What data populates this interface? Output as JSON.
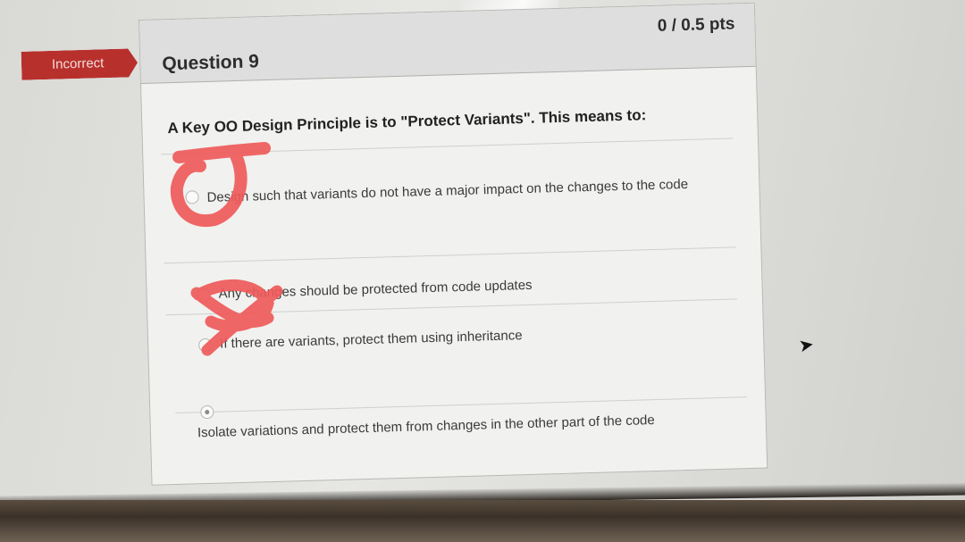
{
  "status_tag": "Incorrect",
  "question": {
    "title": "Question 9",
    "points": "0 / 0.5 pts",
    "prompt": "A Key OO Design Principle is to \"Protect Variants\". This means to:"
  },
  "answers": [
    {
      "text": "Design such that variants do not have a major impact on the changes to the code",
      "selected": false
    },
    {
      "text": "Any changes should be protected from code updates",
      "selected": false
    },
    {
      "text": "If there are variants, protect them using inheritance",
      "selected": false
    },
    {
      "text": "Isolate variations and protect them from changes in the other part of the code",
      "selected": true
    }
  ],
  "colors": {
    "status_tag": "#b8302c",
    "annotation_marker": "#ef5a5a"
  }
}
